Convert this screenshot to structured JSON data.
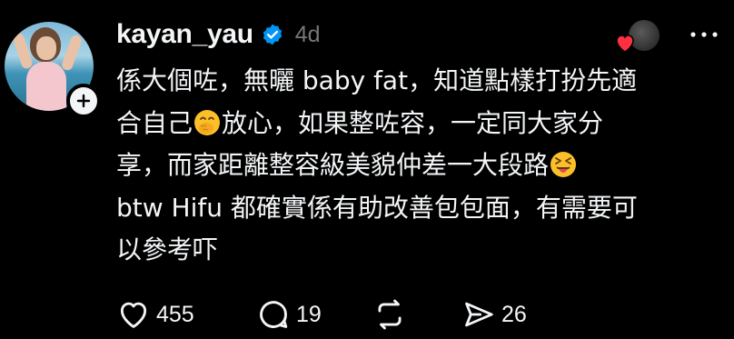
{
  "post": {
    "username": "kayan_yau",
    "time_ago": "4d",
    "lines": [
      "係大個咗，無曬 baby fat，知道點樣打扮先適",
      "合自己",
      "放心，如果整咗容，一定同大家分",
      "享，而家距離整容級美貌仲差一大段路",
      "btw Hifu 都確實係有助改善包包面，有需要可",
      "以參考吓"
    ],
    "emojis": [
      "face-with-hand-over-mouth-emoji",
      "squinting-face-with-tongue-emoji"
    ]
  },
  "actions": {
    "likes": "455",
    "replies": "19",
    "shares": "26"
  },
  "colors": {
    "background": "#000000",
    "text": "#f3f5f7",
    "muted": "#777777",
    "verified": "#0095f6",
    "heart": "#ff3040",
    "emoji": "#fbbf2a"
  },
  "icons": [
    "verified-badge-icon",
    "plus-icon",
    "heart-icon",
    "more-icon",
    "like-icon",
    "reply-icon",
    "repost-icon",
    "share-icon"
  ]
}
